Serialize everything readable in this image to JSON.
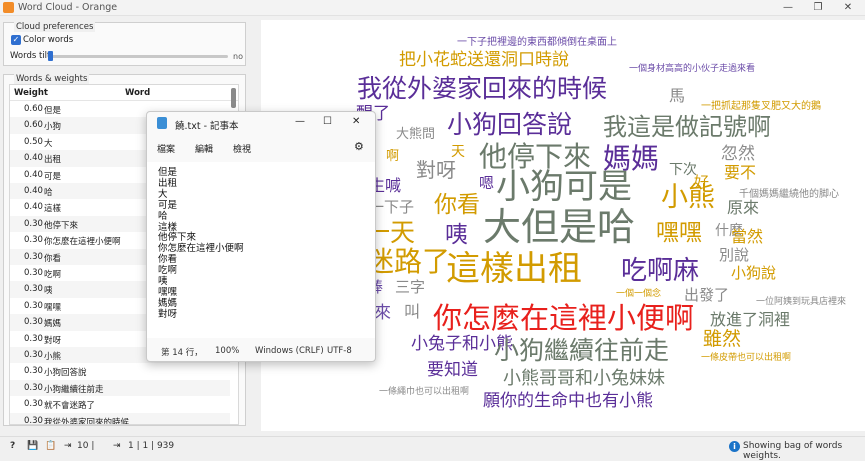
{
  "window": {
    "title": "Word Cloud - Orange",
    "minimize": "—",
    "restore": "❐",
    "close": "✕"
  },
  "settings": {
    "cloud_section": "Cloud preferences",
    "color_words_label": "Color words",
    "color_words_checked": true,
    "words_tilt_label": "Words tilt:",
    "tilt_value_label": "no",
    "tilt_level": 0
  },
  "weights": {
    "section": "Words & weights",
    "col_weight": "Weight",
    "col_word": "Word",
    "rows": [
      {
        "w": "0.60",
        "word": "但是"
      },
      {
        "w": "0.60",
        "word": "小狗"
      },
      {
        "w": "0.50",
        "word": "大"
      },
      {
        "w": "0.40",
        "word": "出租"
      },
      {
        "w": "0.40",
        "word": "可是"
      },
      {
        "w": "0.40",
        "word": "哈"
      },
      {
        "w": "0.40",
        "word": "這樣"
      },
      {
        "w": "0.30",
        "word": "他停下來"
      },
      {
        "w": "0.30",
        "word": "你怎麼在這裡小便啊"
      },
      {
        "w": "0.30",
        "word": "你看"
      },
      {
        "w": "0.30",
        "word": "吃啊"
      },
      {
        "w": "0.30",
        "word": "咦"
      },
      {
        "w": "0.30",
        "word": "嘿嘿"
      },
      {
        "w": "0.30",
        "word": "媽媽"
      },
      {
        "w": "0.30",
        "word": "對呀"
      },
      {
        "w": "0.30",
        "word": "小熊"
      },
      {
        "w": "0.30",
        "word": "小狗回答說"
      },
      {
        "w": "0.30",
        "word": "小狗繼續往前走"
      },
      {
        "w": "0.30",
        "word": "就不會迷路了"
      },
      {
        "w": "0.30",
        "word": "我從外婆家回來的時候"
      }
    ]
  },
  "statusbar": {
    "help": "?",
    "save": "💾",
    "report": "📋",
    "input_count": "10 |",
    "output_label": "1 | 1 | 939",
    "message": "Showing bag of words weights."
  },
  "notepad": {
    "title": "饒.txt - 記事本",
    "menu": [
      "檔案",
      "編輯",
      "檢視"
    ],
    "lines": [
      "但是",
      "出租",
      "大",
      "可是",
      "哈",
      "這樣",
      "他停下來",
      "你怎麼在這裡小便啊",
      "你看",
      "吃啊",
      "咦",
      "嘿嘿",
      "媽媽",
      "對呀"
    ],
    "status_line": "第 14 行，",
    "status_zoom": "100%",
    "status_eol": "Windows (CRLF)",
    "status_enc": "UTF-8"
  },
  "cloud_words": [
    {
      "text": "一下子把裡邊的東西都傾倒在桌面上",
      "color": "#6b4ca8"
    },
    {
      "text": "把小花蛇送還洞口時說",
      "color": "#d29b00"
    },
    {
      "text": "一個身材高高的小伙子走過來看",
      "color": "#6b4ca8"
    },
    {
      "text": "我從外婆家回來的時候",
      "color": "#5a2e98"
    },
    {
      "text": "馬",
      "color": "#8a8a8a"
    },
    {
      "text": "一把抓起那隻叉肥又大的鵝",
      "color": "#d29b00"
    },
    {
      "text": "醒了",
      "color": "#5a2e98"
    },
    {
      "text": "小狗回答說",
      "color": "#5a2e98"
    },
    {
      "text": "我這是做記號啊",
      "color": "#6b7a6b"
    },
    {
      "text": "大熊問",
      "color": "#8a8a8a"
    },
    {
      "text": "啊",
      "color": "#d29b00"
    },
    {
      "text": "天",
      "color": "#d29b00"
    },
    {
      "text": "他停下來",
      "color": "#6b7a6b"
    },
    {
      "text": "媽媽",
      "color": "#5a2e98"
    },
    {
      "text": "忽然",
      "color": "#8a8a8a"
    },
    {
      "text": "對呀",
      "color": "#8a8a8a"
    },
    {
      "text": "下次",
      "color": "#6b7a6b"
    },
    {
      "text": "要不",
      "color": "#d29b00"
    },
    {
      "text": "好",
      "color": "#d29b00"
    },
    {
      "text": "生喊",
      "color": "#5a2e98"
    },
    {
      "text": "嗯",
      "color": "#5a2e98"
    },
    {
      "text": "小狗可是",
      "color": "#6b7a6b"
    },
    {
      "text": "小熊",
      "color": "#d29b00"
    },
    {
      "text": "千個媽媽繼繞他的脚心",
      "color": "#8a8a8a"
    },
    {
      "text": "一下子",
      "color": "#8a8a8a"
    },
    {
      "text": "你看",
      "color": "#d29b00"
    },
    {
      "text": "原來",
      "color": "#6b7a6b"
    },
    {
      "text": "一天",
      "color": "#d29b00"
    },
    {
      "text": "咦",
      "color": "#5a2e98"
    },
    {
      "text": "大但是哈",
      "color": "#6b7a6b"
    },
    {
      "text": "嘿嘿",
      "color": "#d29b00"
    },
    {
      "text": "什麼",
      "color": "#8a8a8a"
    },
    {
      "text": "當然",
      "color": "#d29b00"
    },
    {
      "text": "迷路了",
      "color": "#d29b00"
    },
    {
      "text": "這樣出租",
      "color": "#d29b00"
    },
    {
      "text": "吃啊麻",
      "color": "#5a2e98"
    },
    {
      "text": "別說",
      "color": "#8a8a8a"
    },
    {
      "text": "小狗說",
      "color": "#d29b00"
    },
    {
      "text": "棒",
      "color": "#6b4ca8"
    },
    {
      "text": "三字",
      "color": "#8a8a8a"
    },
    {
      "text": "一個一個念",
      "color": "#d29b00"
    },
    {
      "text": "出發了",
      "color": "#8a8a8a"
    },
    {
      "text": "一位阿姨到玩具店裡來",
      "color": "#8a8a8a"
    },
    {
      "text": "來",
      "color": "#6b4ca8"
    },
    {
      "text": "叫",
      "color": "#8a8a8a"
    },
    {
      "text": "你怎麼在這裡小便啊",
      "color": "#e8201c"
    },
    {
      "text": "放進了洞裡",
      "color": "#6b7a6b"
    },
    {
      "text": "雖然",
      "color": "#d29b00"
    },
    {
      "text": "小兔子和小熊",
      "color": "#5a2e98"
    },
    {
      "text": "小狗繼續往前走",
      "color": "#6b7a6b"
    },
    {
      "text": "一條皮帶也可以出租啊",
      "color": "#d29b00"
    },
    {
      "text": "要知道",
      "color": "#5a2e98"
    },
    {
      "text": "小熊哥哥和小兔妹妹",
      "color": "#6b7a6b"
    },
    {
      "text": "一條繩巾也可以出租啊",
      "color": "#8a8a8a"
    },
    {
      "text": "願你的生命中也有小熊",
      "color": "#5a2e98"
    }
  ]
}
